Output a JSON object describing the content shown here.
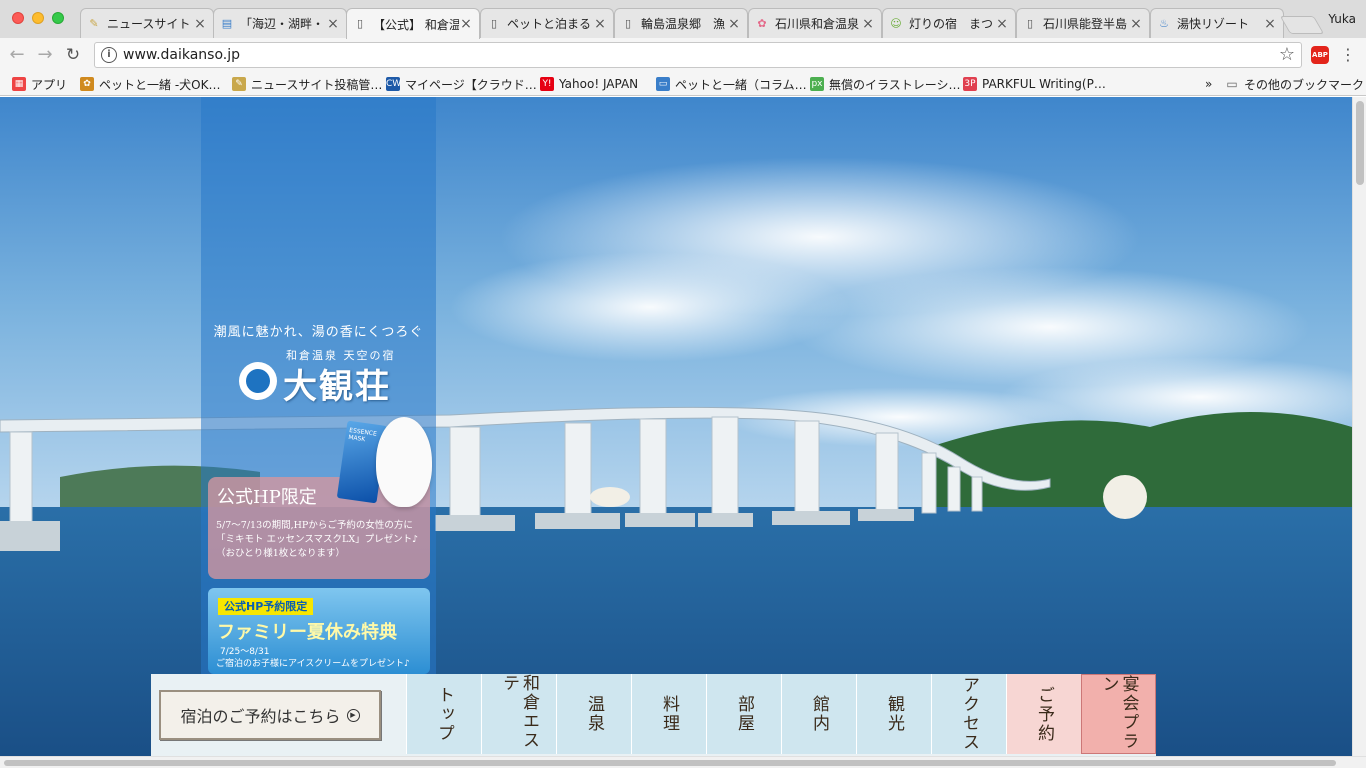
{
  "browser": {
    "tabs": [
      {
        "title": "ニュースサイト",
        "favicon": "pencil-icon",
        "active": false
      },
      {
        "title": "「海辺・湖畔・",
        "favicon": "doc-icon",
        "active": false
      },
      {
        "title": "【公式】 和倉温",
        "favicon": "page-icon",
        "active": true
      },
      {
        "title": "ペットと泊まる",
        "favicon": "page-icon",
        "active": false
      },
      {
        "title": "輪島温泉郷　漁",
        "favicon": "page-icon",
        "active": false
      },
      {
        "title": "石川県和倉温泉",
        "favicon": "flower-icon",
        "active": false
      },
      {
        "title": "灯りの宿　まつ",
        "favicon": "cat-icon",
        "active": false
      },
      {
        "title": "石川県能登半島",
        "favicon": "page-icon",
        "active": false
      },
      {
        "title": "湯快リゾート",
        "favicon": "onsen-icon",
        "active": false
      }
    ],
    "profile_name": "Yuka",
    "url": "www.daikanso.jp",
    "bookmarks": [
      {
        "label": "アプリ",
        "icon": "apps-icon",
        "color": "#e44"
      },
      {
        "label": "ペットと一緒 -犬OK…",
        "icon": "paw-icon",
        "color": "#d08a1f"
      },
      {
        "label": "ニュースサイト投稿管…",
        "icon": "pencil-icon",
        "color": "#c9a84c"
      },
      {
        "label": "マイページ【クラウド…",
        "icon": "cw-icon",
        "color": "#1e5aa8"
      },
      {
        "label": "Yahoo! JAPAN",
        "icon": "yahoo-icon",
        "color": "#e60012"
      },
      {
        "label": "ペットと一緒（コラム…",
        "icon": "window-icon",
        "color": "#3a7ec9"
      },
      {
        "label": "無償のイラストレーシ…",
        "icon": "px-icon",
        "color": "#4caf50"
      },
      {
        "label": "PARKFUL Writing(P…",
        "icon": "parkful-icon",
        "color": "#e04050"
      }
    ],
    "other_bookmarks": "その他のブックマーク",
    "overflow_chevron": "»"
  },
  "site": {
    "tagline": "潮風に魅かれ、湯の香にくつろぐ",
    "subtitle": "和倉温泉 天空の宿",
    "logo_text": "大観荘",
    "promo1": {
      "title": "公式HP限定",
      "body_line1": "5/7〜7/13の期間,HPからご予約の女性の方に",
      "body_line2": "「ミキモト エッセンスマスクLX」プレゼント♪",
      "body_line3": "（おひとり様1枚となります）",
      "product_label": "ESSENCE MASK"
    },
    "promo2": {
      "badge": "公式HP予約限定",
      "title": "ファミリー夏休み特典",
      "dates": "7/25〜8/31",
      "body": "ご宿泊のお子様にアイスクリームをプレゼント♪"
    },
    "reserve_button": "宿泊のご予約はこちら",
    "reserve_arrow": "▶",
    "nav": [
      {
        "label": "トップ",
        "style": "blue"
      },
      {
        "label": "和倉エステ",
        "style": "blue"
      },
      {
        "label": "温泉",
        "style": "blue"
      },
      {
        "label": "料理",
        "style": "blue"
      },
      {
        "label": "部屋",
        "style": "blue"
      },
      {
        "label": "館内",
        "style": "blue"
      },
      {
        "label": "観光",
        "style": "blue"
      },
      {
        "label": "アクセス",
        "style": "blue"
      },
      {
        "label": "ご予約",
        "style": "pink"
      },
      {
        "label": "宴会プラン",
        "style": "pink2"
      }
    ]
  },
  "colors": {
    "sky_top": "#4a8fcf",
    "sea": "#1f5d96",
    "panel_blue": "#2878c8",
    "promo_pink": "#d296a0"
  }
}
